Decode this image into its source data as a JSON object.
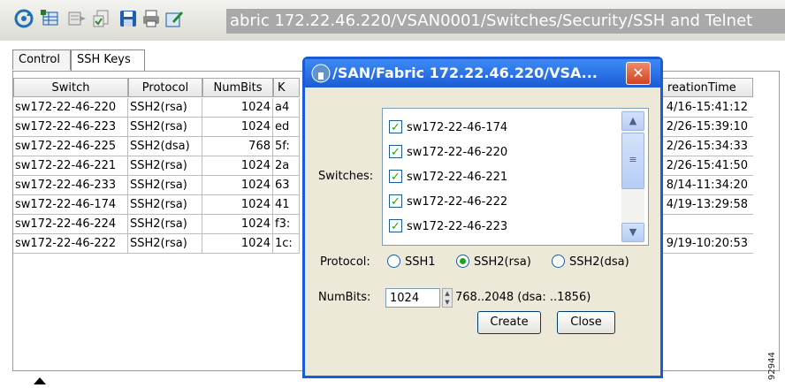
{
  "titlebar": {
    "path": "abric 172.22.46.220/VSAN0001/Switches/Security/SSH and Telnet",
    "icons": [
      "refresh-icon",
      "table-icon",
      "export-icon",
      "apply-icon",
      "save-icon",
      "print-icon",
      "edit-icon"
    ]
  },
  "tabs": [
    {
      "label": "Control",
      "selected": false
    },
    {
      "label": "SSH Keys",
      "selected": true
    }
  ],
  "table": {
    "columns": [
      "Switch",
      "Protocol",
      "NumBits",
      "K",
      "reationTime"
    ],
    "rows": [
      {
        "switch": "sw172-22-46-220",
        "protocol": "SSH2(rsa)",
        "numbits": "1024",
        "key": "a4",
        "time": "4/16-15:41:12"
      },
      {
        "switch": "sw172-22-46-223",
        "protocol": "SSH2(rsa)",
        "numbits": "1024",
        "key": "ed",
        "time": "2/26-15:39:10"
      },
      {
        "switch": "sw172-22-46-225",
        "protocol": "SSH2(dsa)",
        "numbits": "768",
        "key": "5f:",
        "time": "2/26-15:34:33"
      },
      {
        "switch": "sw172-22-46-221",
        "protocol": "SSH2(rsa)",
        "numbits": "1024",
        "key": "2a",
        "time": "2/26-15:41:50"
      },
      {
        "switch": "sw172-22-46-233",
        "protocol": "SSH2(rsa)",
        "numbits": "1024",
        "key": "63",
        "time": "8/14-11:34:20"
      },
      {
        "switch": "sw172-22-46-174",
        "protocol": "SSH2(rsa)",
        "numbits": "1024",
        "key": "41",
        "time": "4/19-13:29:58"
      },
      {
        "switch": "sw172-22-46-224",
        "protocol": "SSH2(rsa)",
        "numbits": "1024",
        "key": "f3:",
        "time": ""
      },
      {
        "switch": "sw172-22-46-222",
        "protocol": "SSH2(rsa)",
        "numbits": "1024",
        "key": "1c:",
        "time": "9/19-10:20:53"
      }
    ]
  },
  "dialog": {
    "title": "/SAN/Fabric 172.22.46.220/VSA...",
    "switches_label": "Switches:",
    "switches": [
      {
        "name": "sw172-22-46-174",
        "checked": true
      },
      {
        "name": "sw172-22-46-220",
        "checked": true
      },
      {
        "name": "sw172-22-46-221",
        "checked": true
      },
      {
        "name": "sw172-22-46-222",
        "checked": true
      },
      {
        "name": "sw172-22-46-223",
        "checked": true
      }
    ],
    "protocol_label": "Protocol:",
    "protocols": [
      {
        "label": "SSH1",
        "selected": false
      },
      {
        "label": "SSH2(rsa)",
        "selected": true
      },
      {
        "label": "SSH2(dsa)",
        "selected": false
      }
    ],
    "numbits_label": "NumBits:",
    "numbits_value": "1024",
    "numbits_range": "768..2048 (dsa: ..1856)",
    "create_label": "Create",
    "close_label": "Close"
  },
  "watermark": "92944",
  "colors": {
    "title_blue": "#1c5bd6",
    "check_green": "#21a121",
    "path_bg": "#a9a9a9"
  }
}
